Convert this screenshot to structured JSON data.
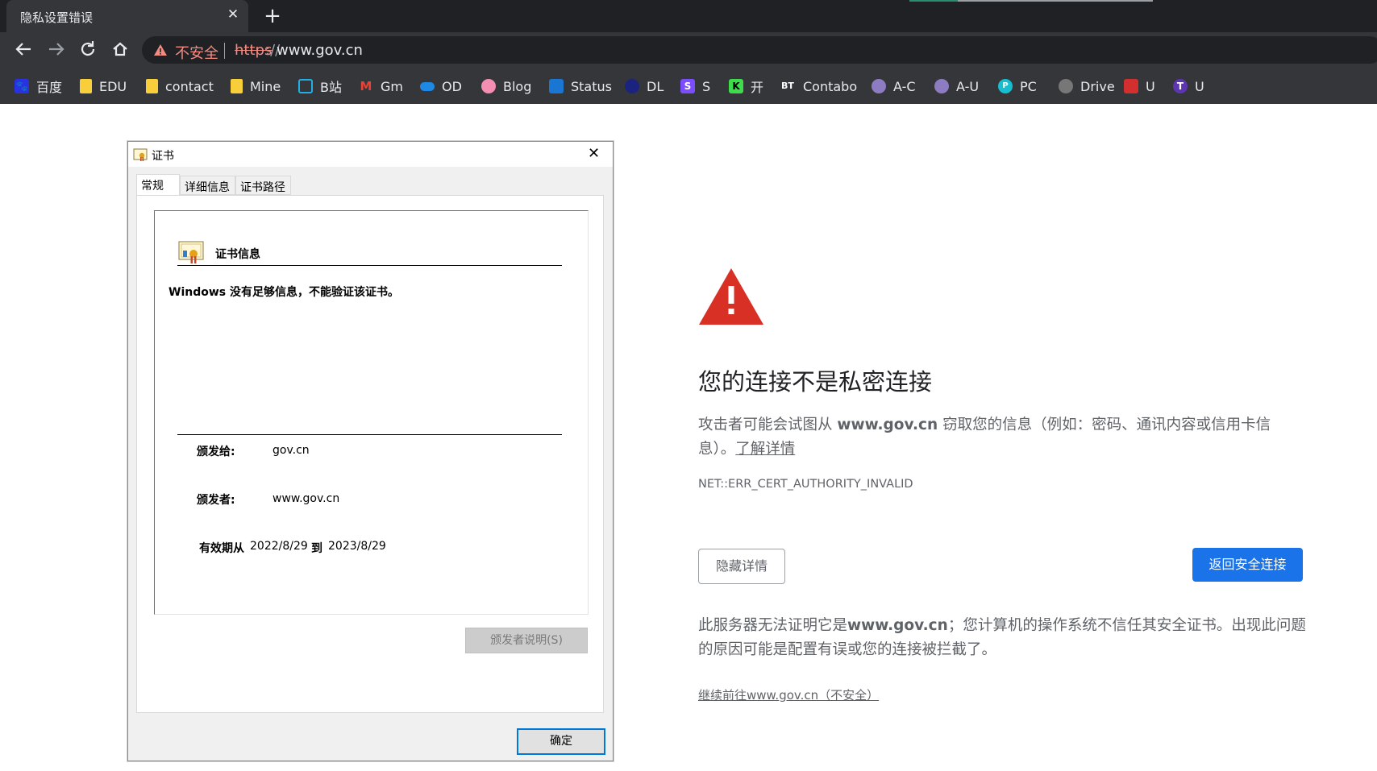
{
  "tab": {
    "title": "隐私设置错误",
    "close": "✕",
    "new": "+"
  },
  "omnibox": {
    "insecure_label": "不安全",
    "url_scheme": "https",
    "url_sep": "://",
    "url_host": "www.gov.cn"
  },
  "bookmarks": [
    {
      "label": "百度",
      "icon": "baidu-icon",
      "color": "#2932e1"
    },
    {
      "label": "EDU",
      "icon": "folder-icon",
      "color": "#f9ce3b"
    },
    {
      "label": "contact",
      "icon": "folder-icon",
      "color": "#f9ce3b"
    },
    {
      "label": "Mine",
      "icon": "folder-icon",
      "color": "#f9ce3b"
    },
    {
      "label": "B站",
      "icon": "bilibili-icon",
      "color": "#23ade5"
    },
    {
      "label": "Gm",
      "icon": "gmail-icon",
      "color": "#ea4335"
    },
    {
      "label": "OD",
      "icon": "onedrive-icon",
      "color": "#1e88e5"
    },
    {
      "label": "Blog",
      "icon": "flower-icon",
      "color": "#f48fb1"
    },
    {
      "label": "Status",
      "icon": "status-icon",
      "color": "#1976d2"
    },
    {
      "label": "DL",
      "icon": "dl-icon",
      "color": "#1a237e"
    },
    {
      "label": "S",
      "icon": "s-icon",
      "color": "#7c4dff",
      "glyph": "S"
    },
    {
      "label": "开",
      "icon": "k-icon",
      "color": "#3ddc4a",
      "glyph": "K"
    },
    {
      "label": "Contabo",
      "icon": "bt-icon",
      "color": "#35363a",
      "glyph": "BT"
    },
    {
      "label": "A-C",
      "icon": "tooth-icon",
      "color": "#8e7cc3"
    },
    {
      "label": "A-U",
      "icon": "tooth-icon",
      "color": "#8e7cc3"
    },
    {
      "label": "PC",
      "icon": "pcloud-icon",
      "color": "#17bed0",
      "glyph": "P"
    },
    {
      "label": "Drive",
      "icon": "globe-icon",
      "color": "#777777"
    },
    {
      "label": "U",
      "icon": "box-icon",
      "color": "#d32f2f"
    },
    {
      "label": "U",
      "icon": "t-icon",
      "color": "#5e35b1",
      "glyph": "T"
    }
  ],
  "page": {
    "heading": "您的连接不是私密连接",
    "desc_prefix": "攻击者可能会试图从 ",
    "desc_host": "www.gov.cn",
    "desc_suffix": " 窃取您的信息（例如：密码、通讯内容或信用卡信息）。",
    "learn_more": "了解详情",
    "error_code": "NET::ERR_CERT_AUTHORITY_INVALID",
    "hide_details": "隐藏详情",
    "back_to_safety": "返回安全连接",
    "detail_prefix": "此服务器无法证明它是",
    "detail_host": "www.gov.cn",
    "detail_suffix": "；您计算机的操作系统不信任其安全证书。出现此问题的原因可能是配置有误或您的连接被拦截了。",
    "proceed_link": "继续前往www.gov.cn（不安全）",
    "accent_color": "#1a73e8",
    "warning_color": "#d93025"
  },
  "dialog": {
    "title": "证书",
    "close": "✕",
    "tabs": [
      "常规",
      "详细信息",
      "证书路径"
    ],
    "info_title": "证书信息",
    "message": "Windows 没有足够信息，不能验证该证书。",
    "issued_to_label": "颁发给:",
    "issued_to": "gov.cn",
    "issued_by_label": "颁发者:",
    "issued_by": "www.gov.cn",
    "validity_label": "有效期从",
    "valid_from": "2022/8/29",
    "to_label": "到",
    "valid_to": "2023/8/29",
    "issuer_statement": "颁发者说明(S)",
    "ok": "确定"
  }
}
